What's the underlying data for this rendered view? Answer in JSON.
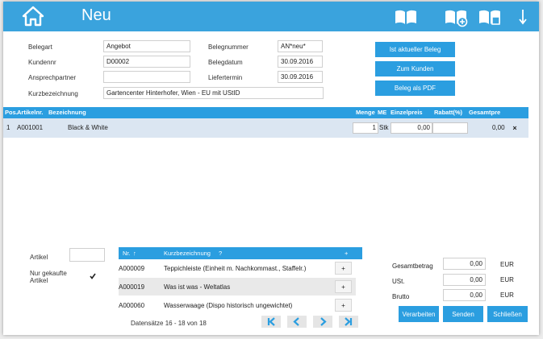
{
  "header": {
    "title": "Neu"
  },
  "form": {
    "belegart_label": "Belegart",
    "belegart_value": "Angebot",
    "kundennr_label": "Kundennr",
    "kundennr_value": "D00002",
    "ansprechpartner_label": "Ansprechpartner",
    "ansprechpartner_value": "",
    "kurzbezeichnung_label": "Kurzbezeichnung",
    "kurzbezeichnung_value": "Gartencenter Hinterhofer, Wien - EU mit UStID",
    "belegnummer_label": "Belegnummer",
    "belegnummer_value": "AN*neu*",
    "belegdatum_label": "Belegdatum",
    "belegdatum_value": "30.09.2016",
    "liefertermin_label": "Liefertermin",
    "liefertermin_value": "30.09.2016"
  },
  "actions": {
    "current_doc": "Ist aktueller Beleg",
    "to_customer": "Zum Kunden",
    "as_pdf": "Beleg als PDF"
  },
  "positions": {
    "columns": [
      "Pos.",
      "Artikelnr.",
      "Bezeichnung",
      "Menge",
      "ME",
      "Einzelpreis",
      "Rabatt(%)",
      "Gesamtpre"
    ],
    "rows": [
      {
        "pos": "1",
        "artikelnr": "A001001",
        "bezeichnung": "Black & White",
        "menge": "1",
        "me": "Stk",
        "einzelpreis": "0,00",
        "rabatt": "",
        "gesamtpreis": "0,00",
        "delete": "×"
      }
    ]
  },
  "article_search": {
    "artikel_label": "Artikel",
    "artikel_value": "",
    "nur_gekaufte_label": "Nur gekaufte Artikel",
    "nur_gekaufte_checked": true,
    "col_nr": "Nr.",
    "col_kurz": "Kurzbezeichnung",
    "col_add": "+",
    "sort_nr": "↑",
    "sort_kurz": "?",
    "rows": [
      {
        "nr": "A000009",
        "kurz": "Teppichleiste (Einheit m. Nachkommast., Staffelr.)",
        "add": "+"
      },
      {
        "nr": "A000019",
        "kurz": "Was ist was - Weltatlas",
        "add": "+"
      },
      {
        "nr": "A000060",
        "kurz": "Wasserwaage (Dispo historisch ungewichtet)",
        "add": "+"
      }
    ],
    "pager_text": "Datensätze 16 - 18 von 18",
    "pager_first": "|◀",
    "pager_prev": "◀",
    "pager_next": "▶",
    "pager_last": "▶|"
  },
  "totals": {
    "gesamtbetrag_label": "Gesamtbetrag",
    "gesamtbetrag_value": "0,00",
    "ust_label": "USt.",
    "ust_value": "0,00",
    "brutto_label": "Brutto",
    "brutto_value": "0,00",
    "currency": "EUR"
  },
  "footer_buttons": {
    "verarbeiten": "Verarbeiten",
    "senden": "Senden",
    "schliessen": "Schließen"
  },
  "colors": {
    "accent": "#3aa3dd",
    "button": "#2b9ee0",
    "row_selected": "#dbe6f2"
  }
}
